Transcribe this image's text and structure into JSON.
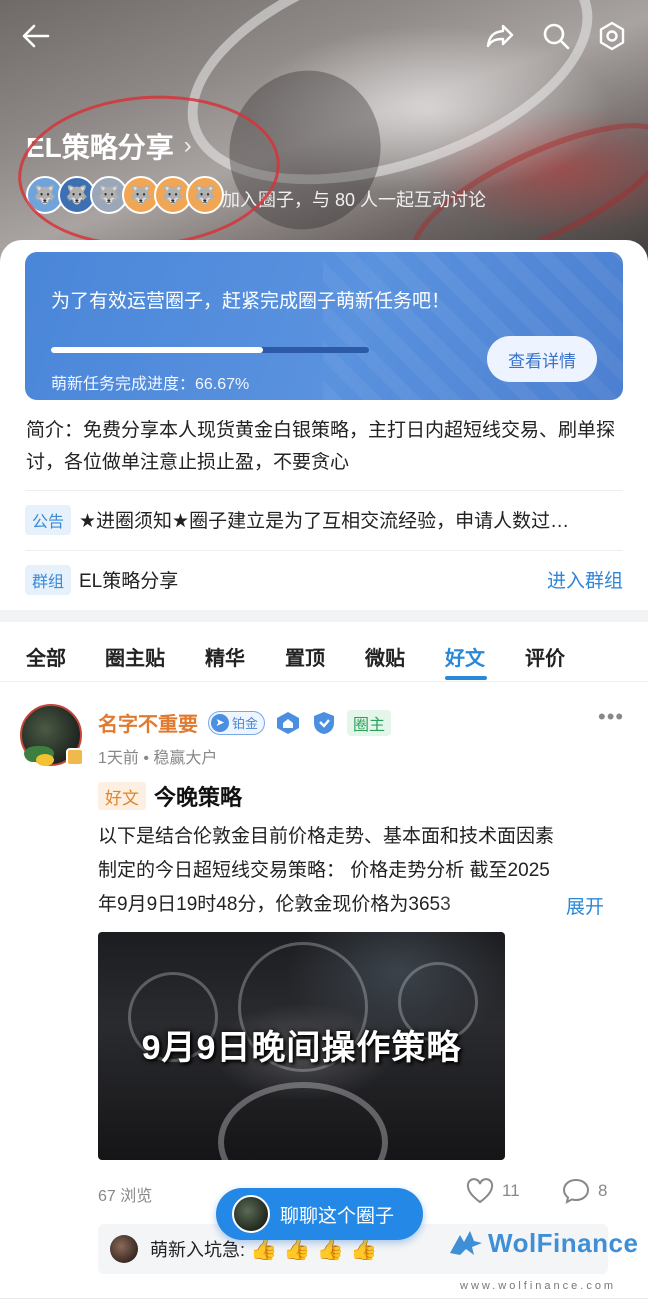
{
  "header": {
    "circle_name": "EL策略分享",
    "join_text": "加入圈子，与 80 人一起互动讨论",
    "member_avatars": [
      {
        "icon": "wolf-mascot-avatar",
        "color": "#6fa3d9",
        "glyph": "🐺"
      },
      {
        "icon": "wolf-mascot-avatar",
        "color": "#3d6fb3",
        "glyph": "🐺"
      },
      {
        "icon": "wolf-mascot-avatar",
        "color": "#9aa7b8",
        "glyph": "🐺"
      },
      {
        "icon": "wolf-mascot-avatar",
        "color": "#f0a653",
        "glyph": "🐺"
      },
      {
        "icon": "wolf-mascot-avatar",
        "color": "#f0a653",
        "glyph": "🐺"
      },
      {
        "icon": "wolf-mascot-avatar",
        "color": "#f0a653",
        "glyph": "🐺"
      }
    ]
  },
  "task_card": {
    "title": "为了有效运营圈子，赶紧完成圈子萌新任务吧！",
    "progress_label": "萌新任务完成进度：66.67%",
    "progress_fraction": 0.6667,
    "detail_button": "查看详情"
  },
  "intro": "简介：免费分享本人现货黄金白银策略，主打日内超短线交易、刷单探讨，各位做单注意止损止盈，不要贪心",
  "notice": {
    "tag": "公告",
    "text": "★进圈须知★圈子建立是为了互相交流经验，申请人数过…"
  },
  "group": {
    "tag": "群组",
    "text": "EL策略分享",
    "action": "进入群组"
  },
  "tabs": [
    {
      "label": "全部",
      "active": false
    },
    {
      "label": "圈主贴",
      "active": false
    },
    {
      "label": "精华",
      "active": false
    },
    {
      "label": "置顶",
      "active": false
    },
    {
      "label": "微贴",
      "active": false
    },
    {
      "label": "好文",
      "active": true
    },
    {
      "label": "评价",
      "active": false
    }
  ],
  "post": {
    "author": "名字不重要",
    "badge_level": "铂金",
    "badge_owner": "圈主",
    "meta": "1天前 • 稳赢大户",
    "tag": "好文",
    "title": "今晚策略",
    "body_line1": "以下是结合伦敦金目前价格走势、基本面和技术面因素",
    "body_line2": "制定的今日超短线交易策略： 价格走势分析 截至2025",
    "body_line3": "年9月9日19时48分，伦敦金现价格为3653",
    "expand": "展开",
    "image_caption": "9月9日晚间操作策略",
    "views": "67 浏览",
    "likes": "11",
    "comments": "8",
    "comment_preview": "萌新入坑急: ",
    "comment_emoji": "👍👍👍👍"
  },
  "chat_button": "聊聊这个圈子",
  "watermark": {
    "brand": "WolFinance",
    "url": "www.wolfinance.com"
  },
  "colors": {
    "accent": "#2a88d8",
    "task_card": "#4a86d9",
    "author": "#e07a30",
    "owner_badge": "#2aa05a",
    "annotation_circle": "#d6343a"
  }
}
